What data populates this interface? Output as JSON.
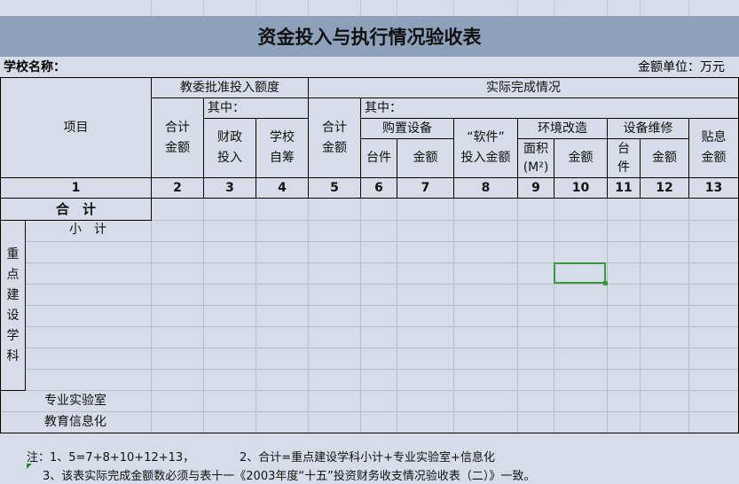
{
  "title": "资金投入与执行情况验收表",
  "school_label": "学校名称：",
  "unit_label": "金额单位：万元",
  "headers": {
    "project": "项目",
    "approved_group": "教委批准投入额度",
    "actual_group": "实际完成情况",
    "approved_total": "合计\n金额",
    "approved_sub": "其中：",
    "finance": "财政\n投入",
    "school_self": "学校\n自筹",
    "actual_total": "合计\n金额",
    "actual_sub": "其中：",
    "purchase_equipment": "购置设备",
    "units": "台件",
    "amount": "金额",
    "software": "“软件”\n投入金额",
    "env_improve": "环境改造",
    "area": "面积\n(M²)",
    "env_amount": "金额",
    "equip_maint": "设备维修",
    "maint_units": "台\n件",
    "maint_amount": "金额",
    "subsidy": "贴息\n金额"
  },
  "column_numbers": [
    "1",
    "2",
    "3",
    "4",
    "5",
    "6",
    "7",
    "8",
    "9",
    "10",
    "11",
    "12",
    "13"
  ],
  "rows": {
    "total": "合　计",
    "subtotal": "小　计",
    "key_discipline_chars": [
      "重",
      "点",
      "建",
      "设",
      "学",
      "科"
    ],
    "lab": "专业实验室",
    "it": "教育信息化"
  },
  "notes": {
    "line1a": "注：1、5=7+8+10+12+13，",
    "line1b": "2、合计=重点建设学科小计+专业实验室+信息化",
    "line2": "3、该表实际完成金额数必须与表十一《2003年度“十五”投资财务收支情况验收表（二）》一致。"
  }
}
